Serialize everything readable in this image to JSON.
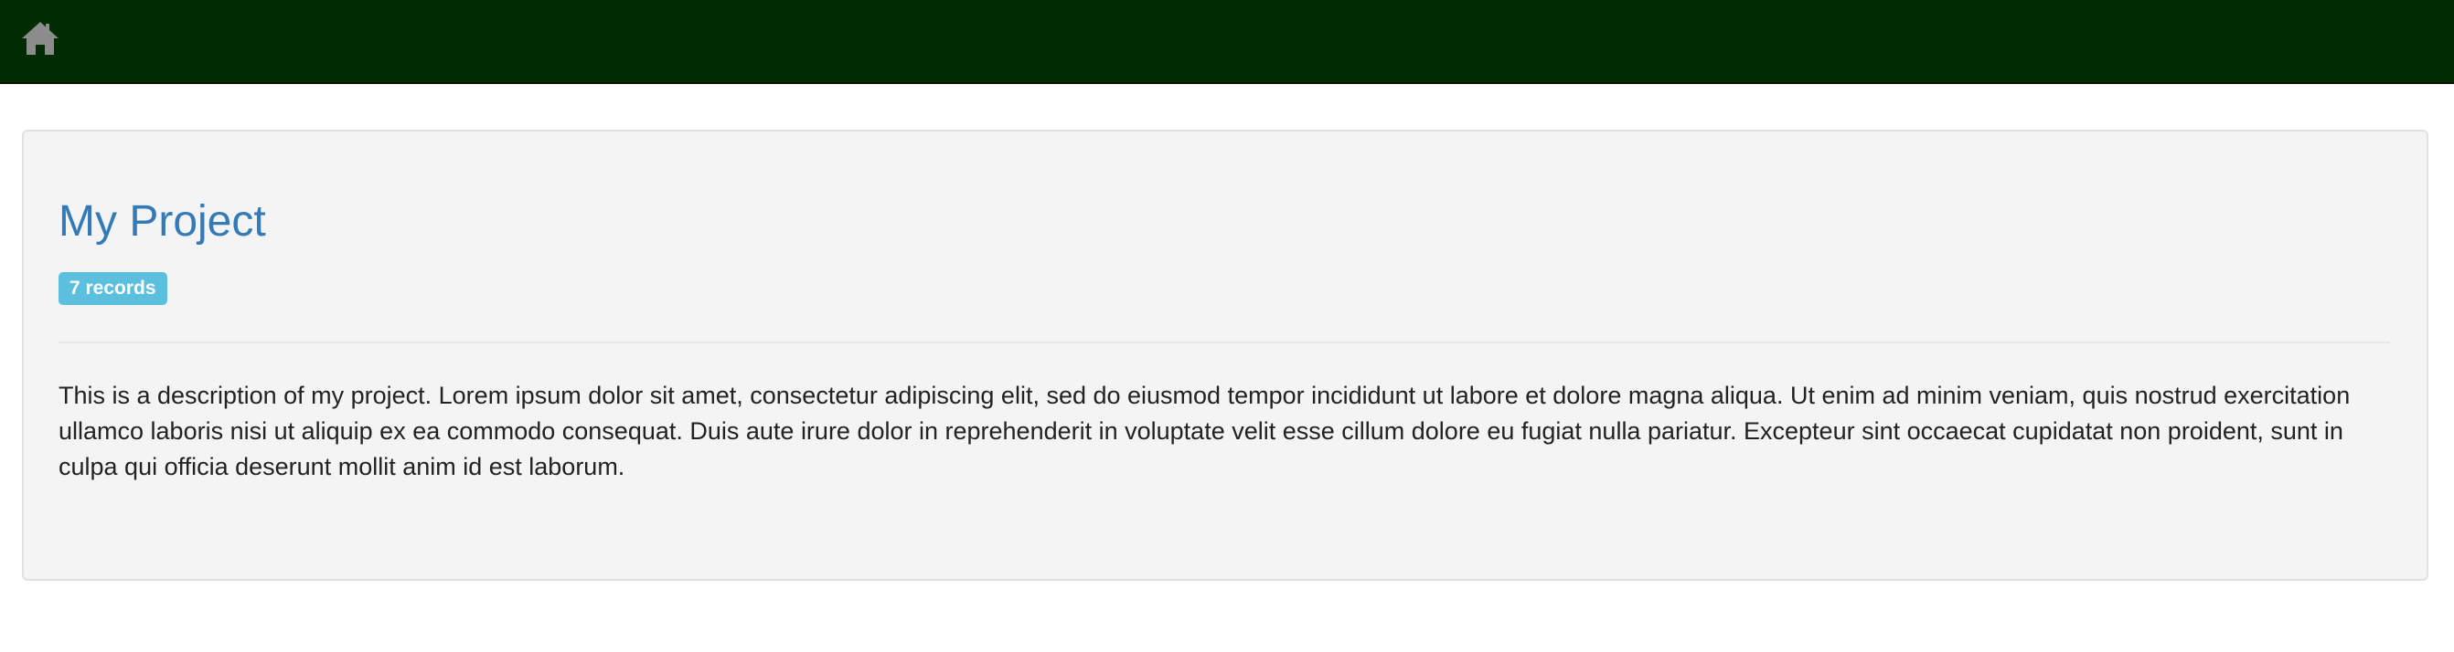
{
  "navbar": {
    "home_icon": "home-icon",
    "background_color": "#012b00"
  },
  "project": {
    "title": "My Project",
    "records_badge": "7 records",
    "description": "This is a description of my project. Lorem ipsum dolor sit amet, consectetur adipiscing elit, sed do eiusmod tempor incididunt ut labore et dolore magna aliqua. Ut enim ad minim veniam, quis nostrud exercitation ullamco laboris nisi ut aliquip ex ea commodo consequat. Duis aute irure dolor in reprehenderit in voluptate velit esse cillum dolore eu fugiat nulla pariatur. Excepteur sint occaecat cupidatat non proident, sunt in culpa qui officia deserunt mollit anim id est laborum.",
    "title_color": "#337ab7",
    "badge_color": "#5bc0de"
  }
}
